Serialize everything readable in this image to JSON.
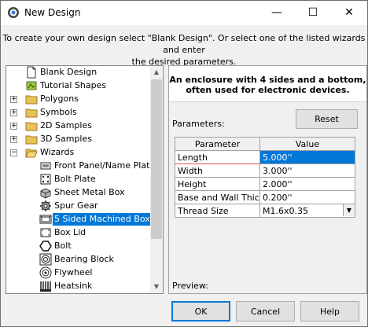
{
  "window": {
    "title": "New Design",
    "minimize_glyph": "—",
    "maximize_glyph": "☐",
    "close_glyph": "✕"
  },
  "instructions": {
    "line1": "To create your own design select \"Blank Design\". Or select one of the listed wizards and enter",
    "line2": "the desired parameters."
  },
  "tree": {
    "items": [
      {
        "label": "Blank Design",
        "icon": "blank-doc-icon"
      },
      {
        "label": "Tutorial Shapes",
        "icon": "tutorial-icon"
      },
      {
        "label": "Polygons",
        "icon": "folder-icon"
      },
      {
        "label": "Symbols",
        "icon": "folder-icon"
      },
      {
        "label": "2D Samples",
        "icon": "folder-icon"
      },
      {
        "label": "3D Samples",
        "icon": "folder-icon"
      },
      {
        "label": "Wizards",
        "icon": "open-folder-icon"
      },
      {
        "label": "Front Panel/Name Plate/",
        "icon": "panel-icon"
      },
      {
        "label": "Bolt Plate",
        "icon": "bolt-plate-icon"
      },
      {
        "label": "Sheet Metal Box",
        "icon": "sheet-box-icon"
      },
      {
        "label": "Spur Gear",
        "icon": "gear-icon"
      },
      {
        "label": "5 Sided Machined Box",
        "icon": "machined-box-icon"
      },
      {
        "label": "Box Lid",
        "icon": "box-lid-icon"
      },
      {
        "label": "Bolt",
        "icon": "hex-bolt-icon"
      },
      {
        "label": "Bearing Block",
        "icon": "bearing-icon"
      },
      {
        "label": "Flywheel",
        "icon": "flywheel-icon"
      },
      {
        "label": "Heatsink",
        "icon": "heatsink-icon"
      }
    ],
    "expander_glyph": "+",
    "expanded_glyph": "−",
    "scroll_up": "▲",
    "scroll_down": "▼"
  },
  "description": {
    "line1": "An enclosure with 4 sides and a bottom,",
    "line2": "often used for electronic devices."
  },
  "parameters": {
    "label": "Parameters:",
    "reset_label": "Reset",
    "headers": [
      "Parameter",
      "Value"
    ],
    "rows": [
      {
        "name": "Length",
        "value": "5.000''"
      },
      {
        "name": "Width",
        "value": "3.000''"
      },
      {
        "name": "Height",
        "value": "2.000''"
      },
      {
        "name": "Base and Wall Thickr",
        "value": "0.200''"
      },
      {
        "name": "Thread Size",
        "value": "M1.6x0.35"
      }
    ],
    "combo_glyph": "▼"
  },
  "preview_label": "Preview:",
  "buttons": {
    "ok": "OK",
    "cancel": "Cancel",
    "help": "Help"
  },
  "colors": {
    "selection": "#0078d7",
    "folder": "#e8c15a"
  }
}
